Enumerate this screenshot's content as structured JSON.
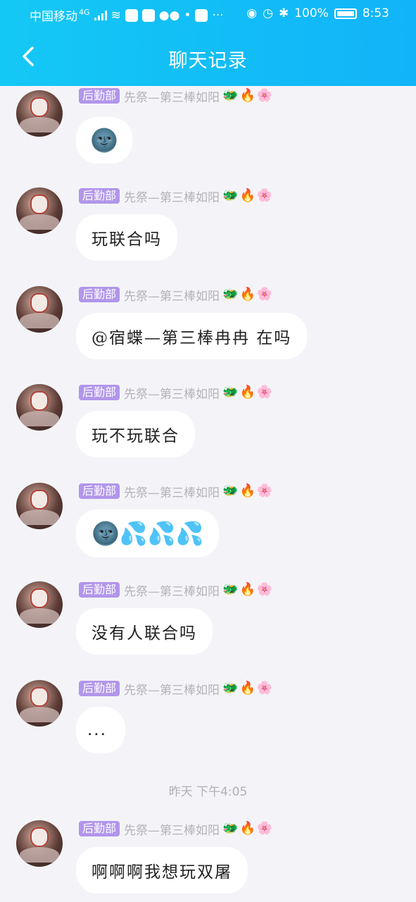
{
  "status_bar": {
    "carrier": "中国移动",
    "network": "4G",
    "battery": "100%",
    "time": "8:53"
  },
  "header": {
    "title": "聊天记录"
  },
  "sender": {
    "badge": "后勤部",
    "name": "先祭—第三棒如阳",
    "title_emojis": [
      "🐲",
      "🔥",
      "🌸"
    ]
  },
  "messages": [
    {
      "text": "🌚"
    },
    {
      "text": "玩联合吗"
    },
    {
      "text": "@宿蝶—第三棒冉冉 在吗"
    },
    {
      "text": "玩不玩联合"
    },
    {
      "text": "🌚💦💦💦"
    },
    {
      "text": "没有人联合吗"
    },
    {
      "text": "..."
    },
    {
      "text": "啊啊啊我想玩双屠"
    }
  ],
  "timestamp": "昨天 下午4:05",
  "colors": {
    "header": "#14c8f5",
    "badge": "#b196ea",
    "background": "#f4f4f8"
  }
}
